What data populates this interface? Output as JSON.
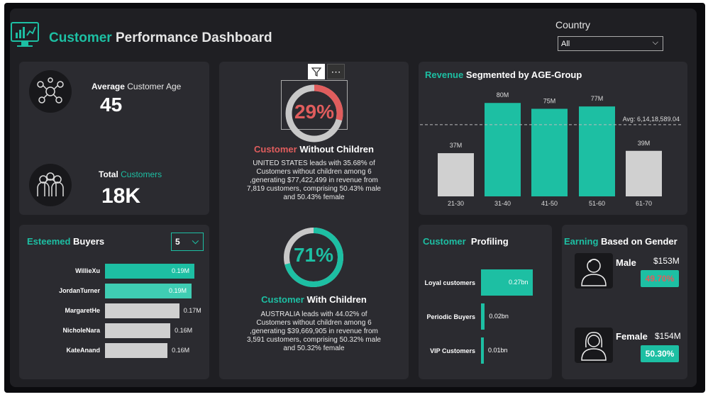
{
  "header": {
    "title_accent": "Customer",
    "title_rest": "Performance Dashboard",
    "country_label": "Country",
    "country_value": "All"
  },
  "kpis": {
    "avg_age_label_1": "Average",
    "avg_age_label_2": "Customer Age",
    "avg_age_value": "45",
    "total_label_1": "Total",
    "total_label_2": "Customers",
    "total_value": "18K"
  },
  "esteemed": {
    "title_accent": "Esteemed",
    "title_rest": "Buyers",
    "topn_value": "5",
    "buyers": [
      {
        "name": "WillieXu",
        "value": 0.19,
        "label": "0.19M"
      },
      {
        "name": "JordanTurner",
        "value": 0.19,
        "label": "0.19M"
      },
      {
        "name": "MargaretHe",
        "value": 0.17,
        "label": "0.17M"
      },
      {
        "name": "NicholeNara",
        "value": 0.16,
        "label": "0.16M"
      },
      {
        "name": "KateAnand",
        "value": 0.16,
        "label": "0.16M"
      }
    ]
  },
  "without_children": {
    "percent": "29%",
    "fraction": 0.29,
    "title_accent": "Customer",
    "title_rest": "Without Children",
    "line1": "UNITED STATES leads with 35.68% of",
    "line2": "Customers without children among 6",
    "line3": ",generating $77,422,499 in revenue from",
    "line4": "7,819 customers, comprising 50.43% male",
    "line5": "and 50.43% female"
  },
  "with_children": {
    "percent": "71%",
    "fraction": 0.71,
    "title_accent": "Customer",
    "title_rest": "With Children",
    "line1": "AUSTRALIA leads with 44.02% of",
    "line2": "Customers without children among 6",
    "line3": ",generating $39,669,905 in revenue from",
    "line4": "3,591 customers, comprising 50.32% male",
    "line5": "and 50.32% female"
  },
  "chart_data": {
    "type": "bar",
    "title": "Revenue Segmented by AGE-Group",
    "categories": [
      "21-30",
      "31-40",
      "41-50",
      "51-60",
      "61-70"
    ],
    "values": [
      37,
      80,
      75,
      77,
      39
    ],
    "labels": [
      "37M",
      "80M",
      "75M",
      "77M",
      "39M"
    ],
    "average_label": "Avg: 6,14,18,589.04",
    "average_value": 61.4,
    "highlight_colors": [
      "#d0d0d0",
      "#1dbfa3",
      "#1dbfa3",
      "#1dbfa3",
      "#d0d0d0"
    ],
    "ylim": [
      0,
      85
    ]
  },
  "profiling": {
    "title_accent": "Customer",
    "title_rest": "Profiling",
    "rows": [
      {
        "name": "Loyal customers",
        "value": 0.27,
        "label": "0.27bn"
      },
      {
        "name": "Periodic Buyers",
        "value": 0.02,
        "label": "0.02bn"
      },
      {
        "name": "VIP Customers",
        "value": 0.01,
        "label": "0.01bn"
      }
    ]
  },
  "gender": {
    "title_accent": "Earning",
    "title_rest": "Based on Gender",
    "male_label": "Male",
    "male_value": "$153M",
    "male_pct": "49.70%",
    "female_label": "Female",
    "female_value": "$154M",
    "female_pct": "50.30%"
  },
  "colors": {
    "accent": "#1dbfa3",
    "negative": "#e05d5d",
    "card": "#2b2b30"
  }
}
